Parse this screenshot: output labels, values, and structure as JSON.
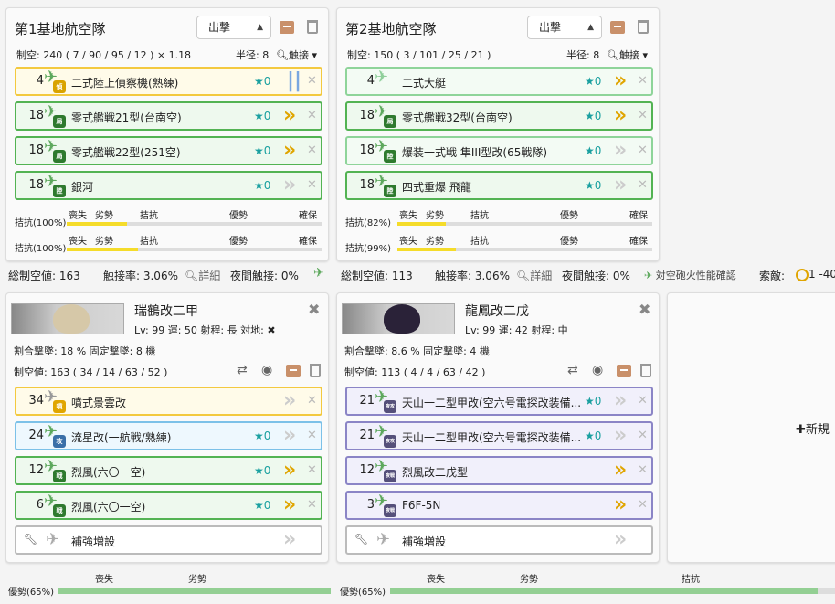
{
  "colors": {
    "accent_gold": "#e0a500",
    "star_teal": "#1aa0a0",
    "bar_yellow": "#f5dc2a",
    "bar_green": "#93cf93"
  },
  "air_bases": [
    {
      "title": "第1基地航空隊",
      "sortie": "出撃",
      "air_power_line": "制空: 240 ( 7 / 90 / 95 / 12 ) × 1.18",
      "radius_label": "半径: 8",
      "contact_label": "触接",
      "slots": [
        {
          "count": "4",
          "icon": "recon-plane-icon",
          "badge": "偵",
          "name": "二式陸上偵察機(熟練)",
          "star": "★0",
          "prof": "||"
        },
        {
          "count": "18",
          "icon": "fighter-plane-icon",
          "badge": "局",
          "name": "零式艦戦21型(台南空)",
          "star": "★0",
          "prof": "»"
        },
        {
          "count": "18",
          "icon": "fighter-plane-icon",
          "badge": "局",
          "name": "零式艦戦22型(251空)",
          "star": "★0",
          "prof": "»"
        },
        {
          "count": "18",
          "icon": "bomber-plane-icon",
          "badge": "陸",
          "name": "銀河",
          "star": "★0",
          "prof": "»"
        }
      ],
      "gauges": [
        {
          "label": "拮抗(100%)",
          "ratio": 1.0
        },
        {
          "label": "拮抗(100%)",
          "ratio": 1.0
        }
      ],
      "gauge_ticks": [
        "喪失",
        "劣勢",
        "拮抗",
        "優勢",
        "確保"
      ]
    },
    {
      "title": "第2基地航空隊",
      "sortie": "出撃",
      "air_power_line": "制空: 150 ( 3 / 101 / 25 / 21 )",
      "radius_label": "半径: 8",
      "contact_label": "触接",
      "slots": [
        {
          "count": "4",
          "icon": "flying-boat-icon",
          "badge": "",
          "name": "二式大艇",
          "star": "★0",
          "prof": "»"
        },
        {
          "count": "18",
          "icon": "fighter-plane-icon",
          "badge": "局",
          "name": "零式艦戦32型(台南空)",
          "star": "★0",
          "prof": "»"
        },
        {
          "count": "18",
          "icon": "fighter-plane-icon",
          "badge": "陸",
          "name": "爆装一式戦 隼III型改(65戦隊)",
          "star": "★0",
          "prof": "»"
        },
        {
          "count": "18",
          "icon": "bomber-plane-icon",
          "badge": "陸",
          "name": "四式重爆 飛龍",
          "star": "★0",
          "prof": "»"
        }
      ],
      "gauges": [
        {
          "label": "拮抗(82%)",
          "ratio": 0.82
        },
        {
          "label": "拮抗(99%)",
          "ratio": 0.99
        }
      ],
      "gauge_ticks": [
        "喪失",
        "劣勢",
        "拮抗",
        "優勢",
        "確保"
      ]
    }
  ],
  "summary_left": {
    "total": "総制空値: 163",
    "contact": "触接率: 3.06%",
    "detail": "詳細",
    "night": "夜間触接: 0%"
  },
  "summary_right": {
    "total": "総制空値: 113",
    "contact": "触接率: 3.06%",
    "detail": "詳細",
    "night": "夜間触接: 0%",
    "aa": "対空砲火性能確認",
    "los": "索敵:",
    "los_val": "1 -40"
  },
  "ships": [
    {
      "name": "瑞鶴改二甲",
      "stats": "Lv: 99  運: 50  射程: 長  対地: ✖",
      "shootdown": "割合撃墜: 18 %   固定撃墜: 8 機",
      "air_power": "制空値: 163 ( 34 / 14 / 63 / 52 )",
      "slots": [
        {
          "count": "34",
          "badge": "噴",
          "name": "噴式景雲改",
          "star": "",
          "prof": "»",
          "style": "yellow"
        },
        {
          "count": "24",
          "badge": "攻",
          "name": "流星改(一航戦/熟練)",
          "star": "★0",
          "prof": "»",
          "style": "blue"
        },
        {
          "count": "12",
          "badge": "戦",
          "name": "烈風(六〇一空)",
          "star": "★0",
          "prof": "»",
          "style": "green"
        },
        {
          "count": "6",
          "badge": "戦",
          "name": "烈風(六〇一空)",
          "star": "★0",
          "prof": "»",
          "style": "green"
        }
      ],
      "reinforce": "補強増設",
      "bottom_gauge": {
        "label": "優勢(65%)",
        "ticks": [
          "喪失",
          "劣勢"
        ],
        "ratio": 0.65
      }
    },
    {
      "name": "龍鳳改二戊",
      "stats": "Lv: 99  運: 42  射程: 中",
      "shootdown": "割合撃墜: 8.6 %   固定撃墜: 4 機",
      "air_power": "制空値: 113 ( 4 / 4 / 63 / 42 )",
      "slots": [
        {
          "count": "21",
          "badge": "夜攻",
          "name": "天山一二型甲改(空六号電探改装備...",
          "star": "★0",
          "prof": "»",
          "style": "purple"
        },
        {
          "count": "21",
          "badge": "夜攻",
          "name": "天山一二型甲改(空六号電探改装備...",
          "star": "★0",
          "prof": "»",
          "style": "purple"
        },
        {
          "count": "12",
          "badge": "夜戦",
          "name": "烈風改二戊型",
          "star": "",
          "prof": "»",
          "style": "purple"
        },
        {
          "count": "3",
          "badge": "夜戦",
          "name": "F6F-5N",
          "star": "",
          "prof": "»",
          "style": "purple"
        }
      ],
      "reinforce": "補強増設",
      "bottom_gauge": {
        "label": "優勢(65%)",
        "ticks": [
          "喪失",
          "劣勢",
          "拮抗"
        ],
        "ratio": 0.65
      }
    }
  ],
  "new_ship": "新規"
}
